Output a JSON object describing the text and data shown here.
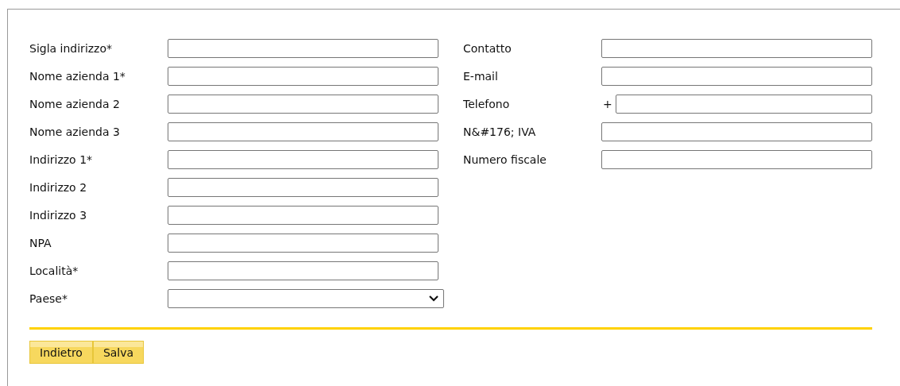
{
  "left_fields": [
    {
      "label": "Sigla indirizzo*",
      "kind": "text"
    },
    {
      "label": "Nome azienda 1*",
      "kind": "text"
    },
    {
      "label": "Nome azienda 2",
      "kind": "text"
    },
    {
      "label": "Nome azienda 3",
      "kind": "text"
    },
    {
      "label": "Indirizzo 1*",
      "kind": "text"
    },
    {
      "label": "Indirizzo 2",
      "kind": "text"
    },
    {
      "label": "Indirizzo 3",
      "kind": "text"
    },
    {
      "label": "NPA",
      "kind": "text"
    },
    {
      "label": "Località*",
      "kind": "text"
    },
    {
      "label": "Paese*",
      "kind": "select"
    }
  ],
  "right_fields": [
    {
      "label": "Contatto",
      "kind": "text"
    },
    {
      "label": "E-mail",
      "kind": "text"
    },
    {
      "label": "Telefono",
      "kind": "text",
      "prefix": "+"
    },
    {
      "label": "N&#176; IVA",
      "kind": "text"
    },
    {
      "label": "Numero fiscale",
      "kind": "text"
    }
  ],
  "buttons": [
    "Indietro",
    "Salva"
  ]
}
